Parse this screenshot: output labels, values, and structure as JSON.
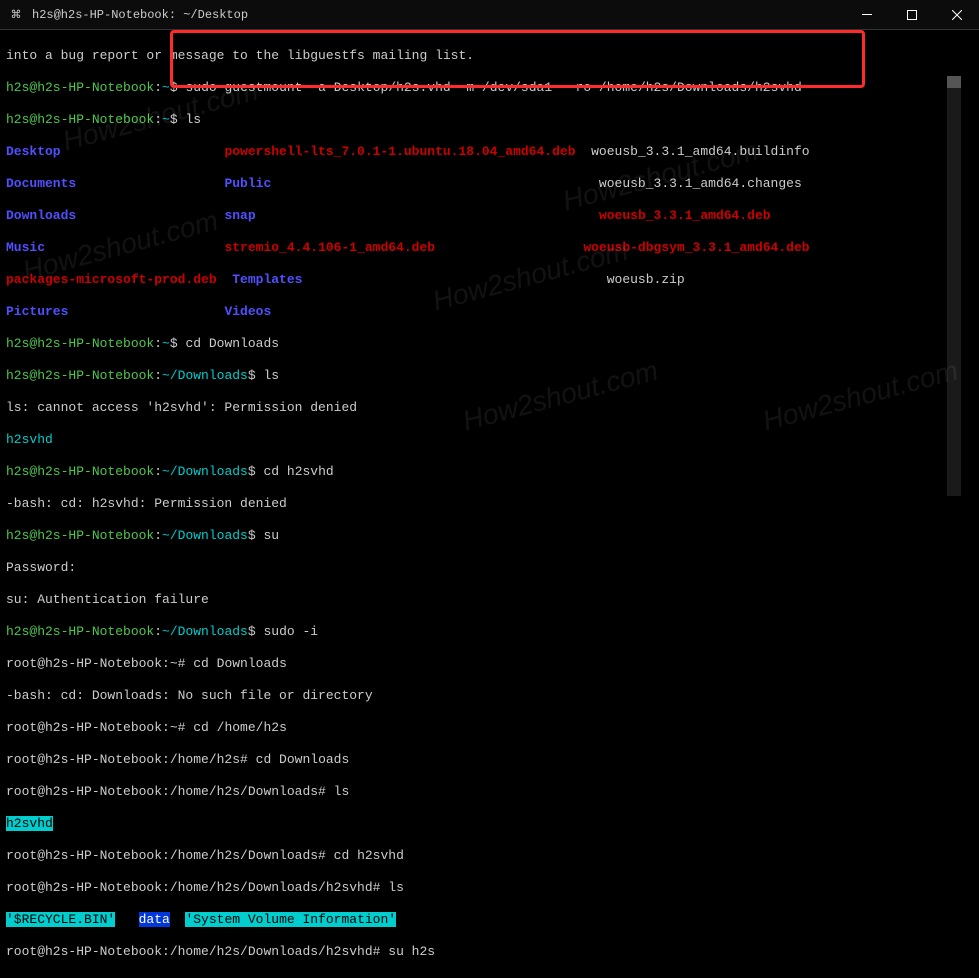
{
  "window": {
    "title": "h2s@h2s-HP-Notebook: ~/Desktop",
    "icon": "⌘"
  },
  "lines": {
    "l1": "into a bug report or message to the libguestfs mailing list.",
    "p1_user": "h2s@h2s-HP-Notebook",
    "p1_path": "~",
    "p1_cmd": "sudo guestmount -a Desktop/h2s.vhd -m /dev/sda1 --ro /home/h2s/Downloads/h2svhd",
    "p2_cmd": "ls",
    "ls1a": "Desktop",
    "ls1b": "powershell-lts_7.0.1-1.ubuntu.18.04_amd64.deb",
    "ls1c": "woeusb_3.3.1_amd64.buildinfo",
    "ls2a": "Documents",
    "ls2b": "Public",
    "ls2c": "woeusb_3.3.1_amd64.changes",
    "ls3a": "Downloads",
    "ls3b": "snap",
    "ls3c": "woeusb_3.3.1_amd64.deb",
    "ls4a": "Music",
    "ls4b": "stremio_4.4.106-1_amd64.deb",
    "ls4c": "woeusb-dbgsym_3.3.1_amd64.deb",
    "ls5a": "packages-microsoft-prod.deb",
    "ls5b": "Templates",
    "ls5c": "woeusb.zip",
    "ls6a": "Pictures",
    "ls6b": "Videos",
    "p3_cmd": "cd Downloads",
    "p4_path": "~/Downloads",
    "p4_cmd": "ls",
    "err1": "ls: cannot access 'h2svhd': Permission denied",
    "out1": "h2svhd",
    "p5_cmd": "cd h2svhd",
    "err2": "-bash: cd: h2svhd: Permission denied",
    "p6_cmd": "su",
    "pw": "Password:",
    "err3": "su: Authentication failure",
    "p7_cmd": "sudo -i",
    "root_prompt1": "root@h2s-HP-Notebook:~#",
    "rcmd1": "cd Downloads",
    "err4": "-bash: cd: Downloads: No such file or directory",
    "rcmd2": "cd /home/h2s",
    "root_prompt2": "root@h2s-HP-Notebook:/home/h2s#",
    "rcmd3": "cd Downloads",
    "root_prompt3": "root@h2s-HP-Notebook:/home/h2s/Downloads#",
    "rcmd4": "ls",
    "out2": "h2svhd",
    "rcmd5": "cd h2svhd",
    "root_prompt4": "root@h2s-HP-Notebook:/home/h2s/Downloads/h2svhd#",
    "rcmd6": "ls",
    "out3a": "'$RECYCLE.BIN'",
    "out3b": "data",
    "out3c": "'System Volume Information'",
    "rcmd7": "su h2s"
  },
  "watermark": "How2shout.com"
}
